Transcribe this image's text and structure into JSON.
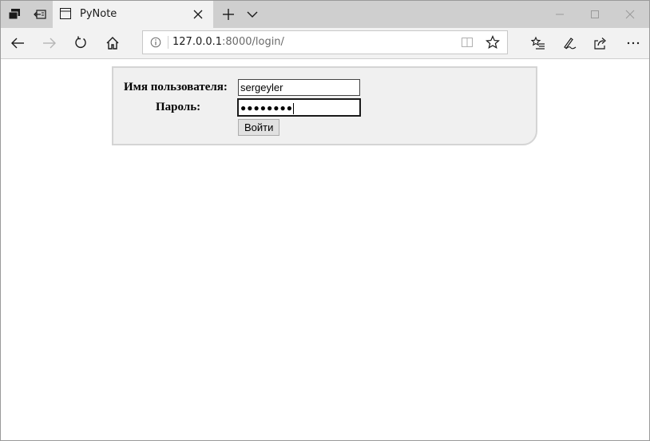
{
  "browser": {
    "tab": {
      "title": "PyNote"
    },
    "address_bar": {
      "url_host": "127.0.0.1",
      "url_rest": ":8000/login/"
    },
    "icons": {
      "tab_actions": "tab-actions-icon",
      "set_aside_tabs": "set-aside-tabs-icon",
      "page": "page-icon",
      "close_tab": "close-icon",
      "new_tab": "plus-icon",
      "tab_list": "chevron-down-icon",
      "minimize": "minimize-icon",
      "maximize": "maximize-icon",
      "close_window": "close-icon",
      "back": "back-arrow-icon",
      "forward": "forward-arrow-icon",
      "refresh": "refresh-icon",
      "home": "home-icon",
      "site_info": "info-icon",
      "reading_view": "reading-view-icon",
      "favorite": "star-icon",
      "favorites_hub": "favorites-hub-icon",
      "notes": "pen-icon",
      "share": "share-icon",
      "more": "more-icon"
    }
  },
  "page": {
    "login_form": {
      "username_label": "Имя пользователя:",
      "username_value": "sergeyler",
      "password_label": "Пароль:",
      "password_mask": "●●●●●●●●",
      "submit_label": "Войти"
    }
  }
}
